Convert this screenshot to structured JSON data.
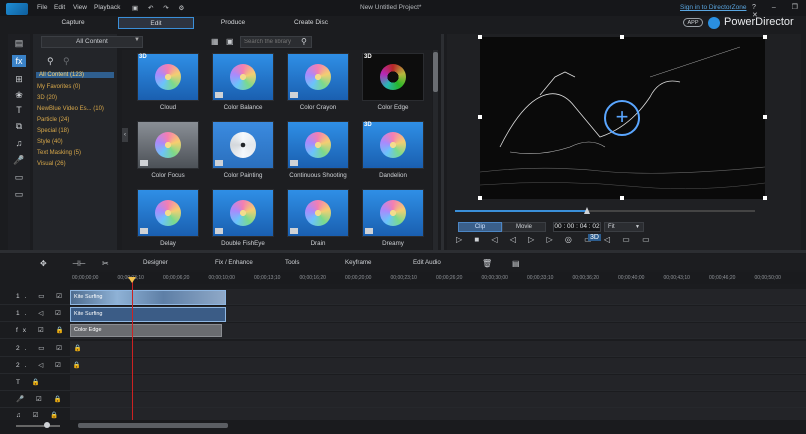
{
  "menu": {
    "items": [
      "File",
      "Edit",
      "View",
      "Playback"
    ]
  },
  "project_title": "New Untitled Project*",
  "signin_link": "Sign in to DirectorZone",
  "app_button": "APP",
  "app_name": "PowerDirector",
  "window_controls": "? – ❐ ✕",
  "tabs": [
    {
      "label": "Capture",
      "active": false
    },
    {
      "label": "Edit",
      "active": true
    },
    {
      "label": "Produce",
      "active": false
    },
    {
      "label": "Create Disc",
      "active": false
    }
  ],
  "library": {
    "category_select": "All Content",
    "search_placeholder": "Search the library",
    "categories": [
      "All Content  (123)",
      "My Favorites  (0)",
      "3D  (20)",
      "NewBlue Video Es...  (10)",
      "Particle  (24)",
      "Special  (18)",
      "Style  (40)",
      "Text Masking  (5)",
      "Visual  (26)"
    ],
    "thumbnails": [
      {
        "label": "Cloud",
        "badge_3d": true
      },
      {
        "label": "Color Balance",
        "badge_3d": false
      },
      {
        "label": "Color Crayon",
        "badge_3d": false
      },
      {
        "label": "Color Edge",
        "badge_3d": true
      },
      {
        "label": "Color Focus",
        "badge_3d": false
      },
      {
        "label": "Color Painting",
        "badge_3d": false
      },
      {
        "label": "Continuous Shooting",
        "badge_3d": false
      },
      {
        "label": "Dandelion",
        "badge_3d": true
      },
      {
        "label": "Delay",
        "badge_3d": false
      },
      {
        "label": "Double FishEye",
        "badge_3d": false
      },
      {
        "label": "Drain",
        "badge_3d": false
      },
      {
        "label": "Dreamy",
        "badge_3d": false
      }
    ],
    "three_d_label": "3D"
  },
  "preview": {
    "clip_label": "Clip",
    "movie_label": "Movie",
    "timecode": "00 : 00 : 04 : 02",
    "fit_label": "Fit",
    "playback_progress": 0.44,
    "transport_icons": "▷ ■ ◁ ◁ ▷ ▷ ◎ ▭ ◁ ▭ ▭",
    "three_d_indicator": "3D"
  },
  "timeline_toolbar": {
    "designer": "Designer",
    "fix_enhance": "Fix / Enhance",
    "tools": "Tools",
    "keyframe": "Keyframe",
    "edit_audio": "Edit Audio"
  },
  "ruler": [
    "00;00;00;00",
    "00;00;03;10",
    "00;00;06;20",
    "00;00;10;00",
    "00;00;13;10",
    "00;00;16;20",
    "00;00;20;00",
    "00;00;23;10",
    "00;00;26;20",
    "00;00;30;00",
    "00;00;33;10",
    "00;00;36;20",
    "00;00;40;00",
    "00;00;43;10",
    "00;00;46;20",
    "00;00;50;00"
  ],
  "tracks": [
    {
      "head": "1. ▭ ☑ 🔒"
    },
    {
      "head": "1. ◁ ☑ 🔒"
    },
    {
      "head": "fx ☑ 🔒"
    },
    {
      "head": "2. ▭ ☑ 🔒"
    },
    {
      "head": "2. ◁ ☑ 🔒"
    },
    {
      "head": "T  🔒"
    },
    {
      "head": "🎤 ☑ 🔒"
    },
    {
      "head": "♫ ☑ 🔒"
    }
  ],
  "clips": {
    "video_label": "Kite Surfing",
    "audio_label": "Kite Surfing",
    "fx_label": "Color Edge"
  }
}
